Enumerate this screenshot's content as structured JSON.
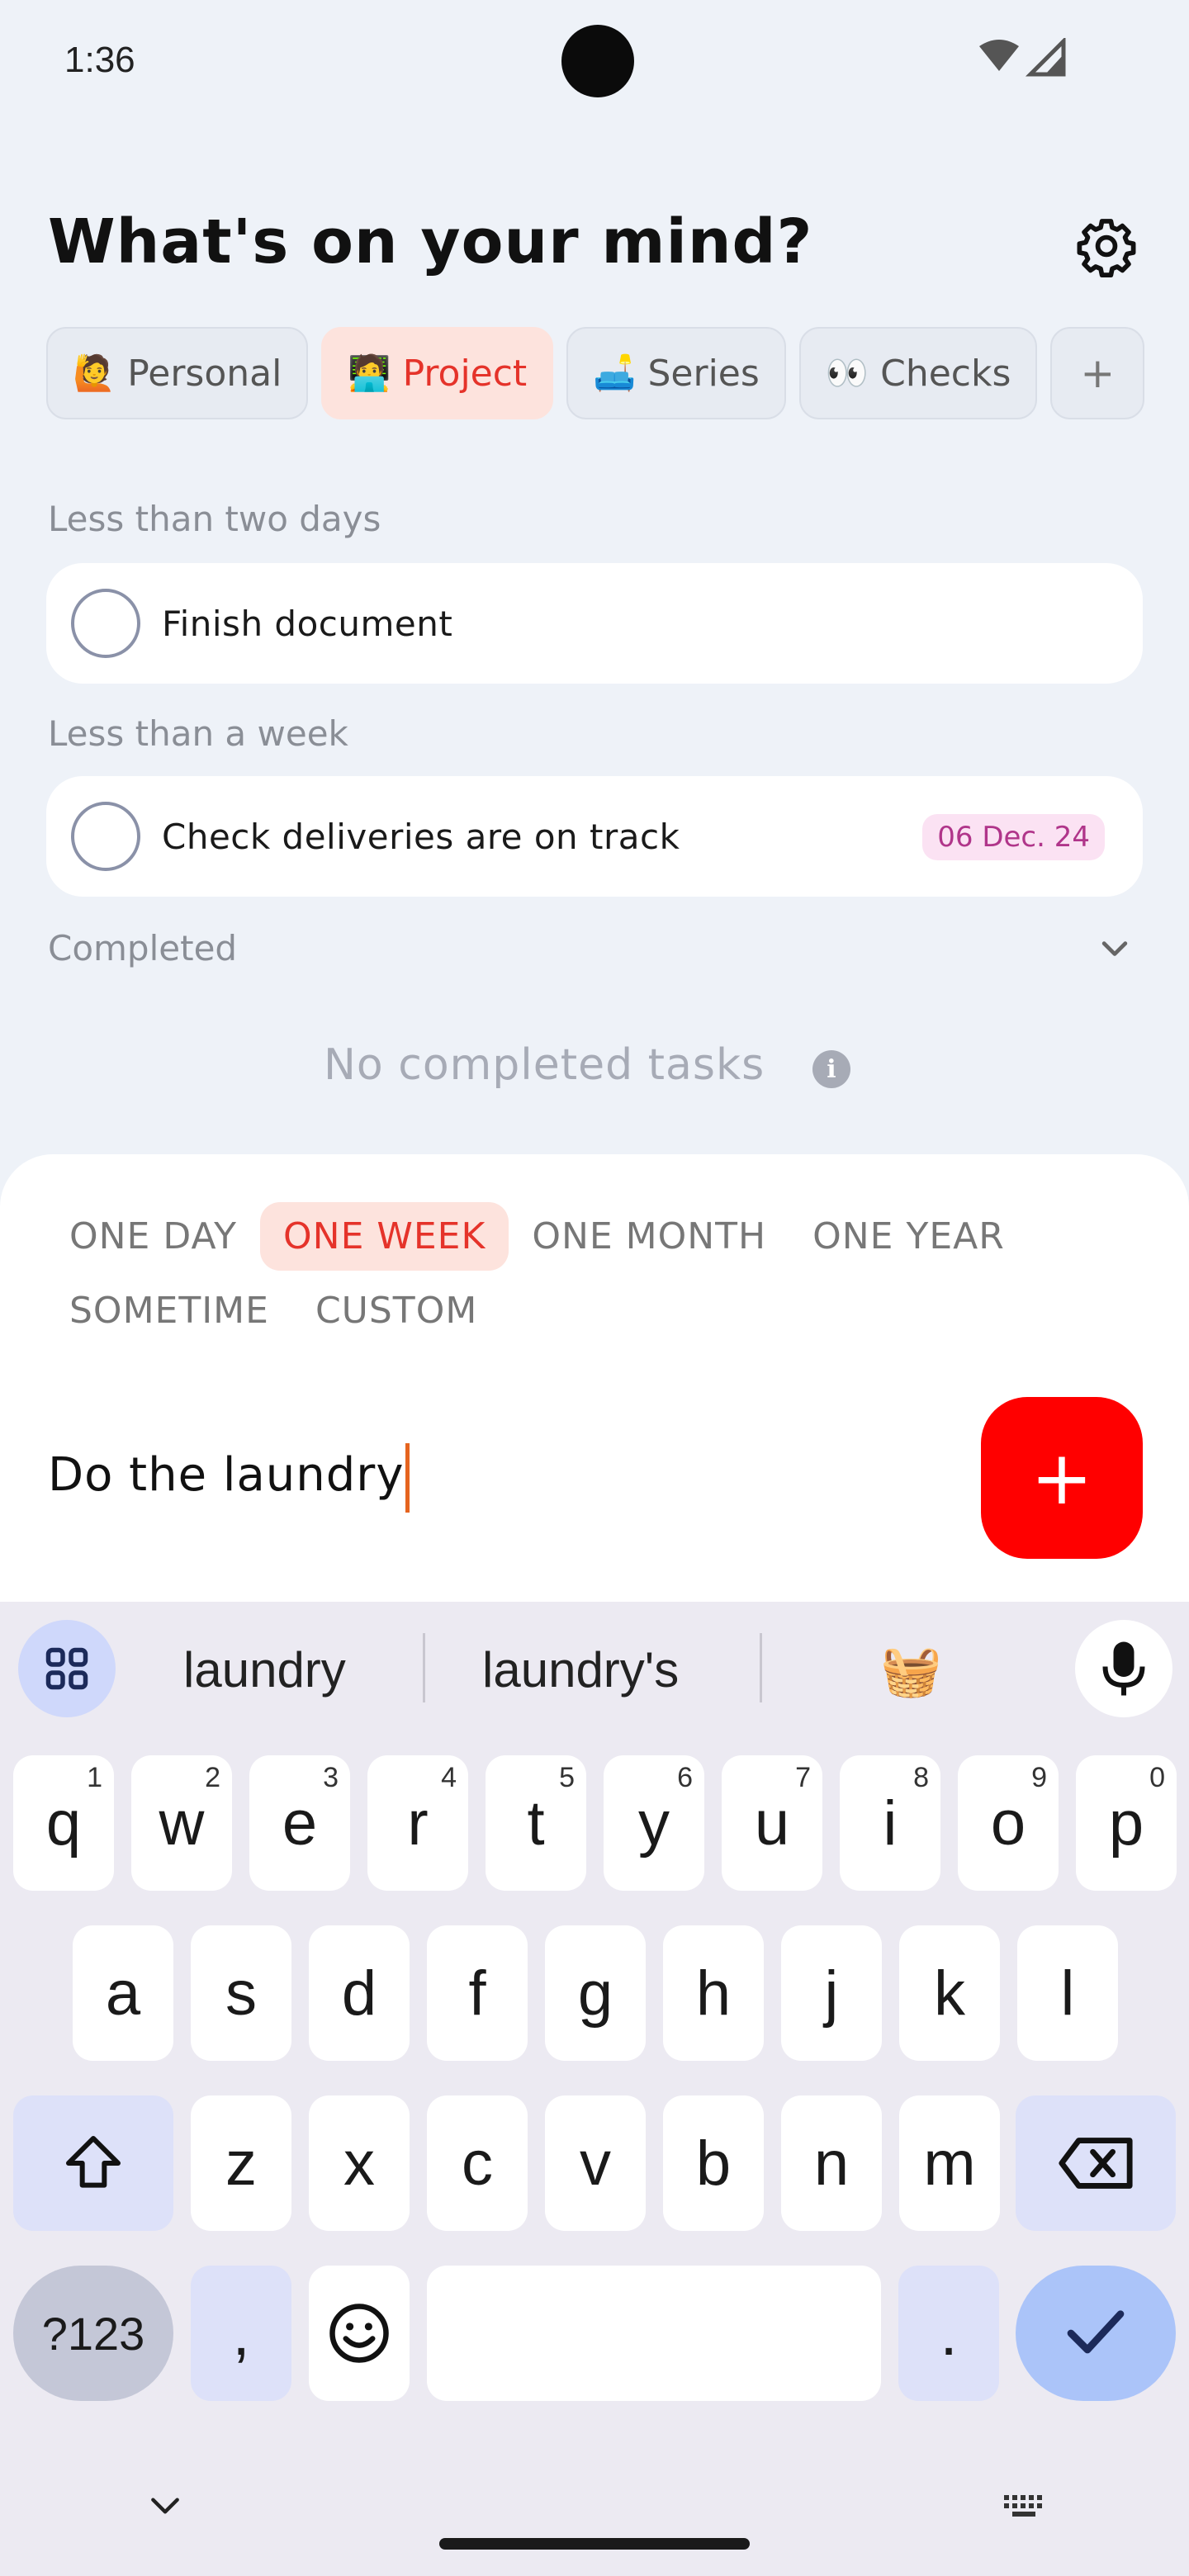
{
  "status": {
    "time": "1:36"
  },
  "header": {
    "title": "What's on your mind?"
  },
  "chips": [
    {
      "emoji": "🙋",
      "label": "Personal"
    },
    {
      "emoji": "🧑‍💻",
      "label": "Project"
    },
    {
      "emoji": "🛋️",
      "label": "Series"
    },
    {
      "emoji": "👀",
      "label": "Checks"
    },
    {
      "emoji": "",
      "label": "+"
    }
  ],
  "sections": {
    "two_days": {
      "label": "Less than two days",
      "task": "Finish document"
    },
    "week": {
      "label": "Less than a week",
      "task": "Check deliveries are on track",
      "due": "06 Dec. 24"
    },
    "completed": {
      "label": "Completed",
      "empty": "No completed tasks"
    }
  },
  "sheet": {
    "ranges": [
      "ONE DAY",
      "ONE WEEK",
      "ONE MONTH",
      "ONE YEAR",
      "SOMETIME",
      "CUSTOM"
    ],
    "selected_range": "ONE WEEK",
    "input_value": "Do the laundry",
    "add_label": "+"
  },
  "keyboard": {
    "suggestions": [
      "laundry",
      "laundry's",
      "🧺"
    ],
    "row1": [
      "q",
      "w",
      "e",
      "r",
      "t",
      "y",
      "u",
      "i",
      "o",
      "p"
    ],
    "row1_nums": [
      "1",
      "2",
      "3",
      "4",
      "5",
      "6",
      "7",
      "8",
      "9",
      "0"
    ],
    "row2": [
      "a",
      "s",
      "d",
      "f",
      "g",
      "h",
      "j",
      "k",
      "l"
    ],
    "row3": [
      "z",
      "x",
      "c",
      "v",
      "b",
      "n",
      "m"
    ],
    "symbols_label": "?123",
    "comma": ",",
    "period": "."
  },
  "colors": {
    "accent": "#ff0000",
    "active_chip_bg": "#fde3dd",
    "active_chip_text": "#e5332a",
    "badge_bg": "#fbe2f3",
    "badge_text": "#b0358a"
  }
}
